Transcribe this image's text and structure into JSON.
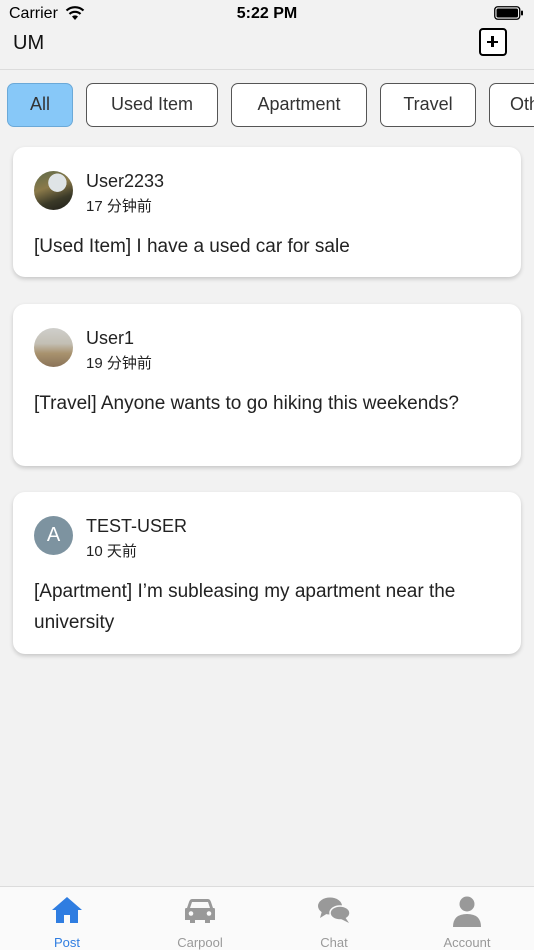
{
  "status_bar": {
    "carrier": "Carrier",
    "time": "5:22 PM"
  },
  "header": {
    "title": "UM",
    "add_icon": "plus-square-icon"
  },
  "filters": [
    {
      "label": "All",
      "active": true
    },
    {
      "label": "Used Item",
      "active": false
    },
    {
      "label": "Apartment",
      "active": false
    },
    {
      "label": "Travel",
      "active": false
    },
    {
      "label": "Other",
      "active": false
    }
  ],
  "posts": [
    {
      "user": "User2233",
      "time": "17 分钟前",
      "text": "[Used Item] I have a used car for sale",
      "avatar": "photo"
    },
    {
      "user": "User1",
      "time": "19 分钟前",
      "text": "[Travel] Anyone wants to go hiking this weekends?",
      "avatar": "photo"
    },
    {
      "user": "TEST-USER",
      "time": "10 天前",
      "text": "[Apartment] I’m subleasing my apartment near the university",
      "avatar_letter": "A"
    }
  ],
  "tabs": [
    {
      "label": "Post",
      "icon": "home-icon",
      "active": true
    },
    {
      "label": "Carpool",
      "icon": "car-icon",
      "active": false
    },
    {
      "label": "Chat",
      "icon": "chat-icon",
      "active": false
    },
    {
      "label": "Account",
      "icon": "user-icon",
      "active": false
    }
  ],
  "colors": {
    "accent": "#2f7de1",
    "chip_active": "#87c8f8",
    "inactive_icon": "#999999"
  }
}
